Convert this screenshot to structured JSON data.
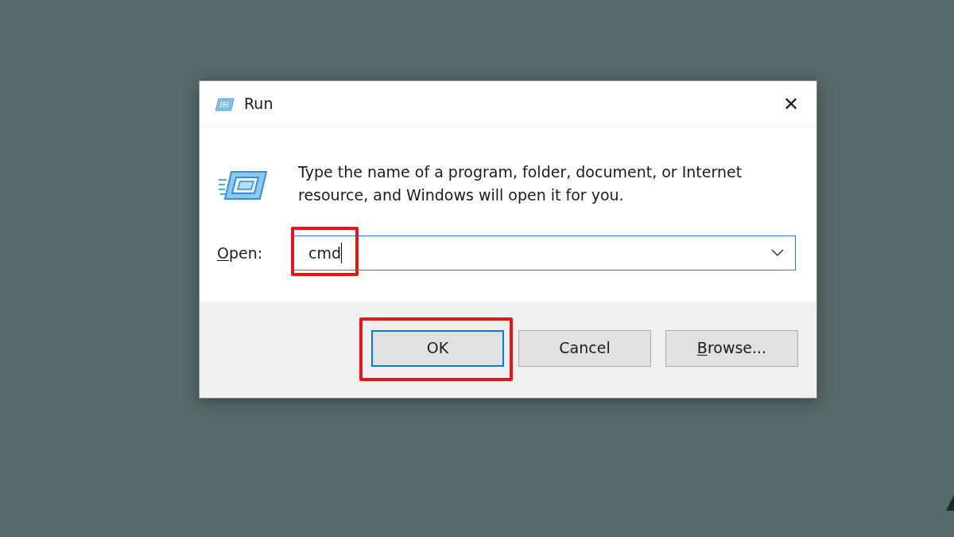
{
  "window": {
    "title": "Run",
    "close": "✕"
  },
  "description": "Type the name of a program, folder, document, or Internet resource, and Windows will open it for you.",
  "open_field": {
    "label_key": "O",
    "label_rest": "pen:",
    "value": "cmd",
    "focused": true,
    "highlighted": true
  },
  "buttons": [
    {
      "label_rest": "OK",
      "default": true,
      "highlighted": true
    },
    {
      "label_rest": "Cancel",
      "default": false,
      "highlighted": false
    },
    {
      "label_key": "B",
      "label_rest": "rowse...",
      "default": false,
      "highlighted": false
    }
  ]
}
